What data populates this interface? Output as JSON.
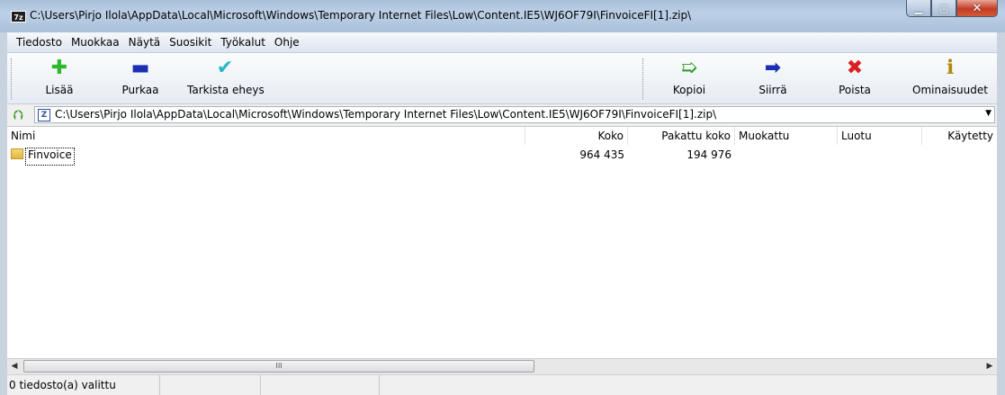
{
  "window": {
    "app_icon_label": "7z",
    "title": "C:\\Users\\Pirjo Ilola\\AppData\\Local\\Microsoft\\Windows\\Temporary Internet Files\\Low\\Content.IE5\\WJ6OF79I\\FinvoiceFI[1].zip\\",
    "min_glyph": "▁",
    "max_glyph": "▢",
    "close_glyph": "✕"
  },
  "menu": [
    "Tiedosto",
    "Muokkaa",
    "Näytä",
    "Suosikit",
    "Työkalut",
    "Ohje"
  ],
  "toolbar": {
    "add": {
      "label": "Lisää",
      "glyph": "✚",
      "icon": "plus-icon",
      "color": "#2fb82a"
    },
    "extract": {
      "label": "Purkaa",
      "glyph": "▬",
      "icon": "minus-icon",
      "color": "#1b2fb3"
    },
    "test": {
      "label": "Tarkista eheys",
      "glyph": "✔",
      "icon": "checkmark-icon",
      "color": "#28b8c8"
    },
    "copy": {
      "label": "Kopioi",
      "glyph": "➯",
      "icon": "copy-arrow-icon",
      "color": "#2a9a2a"
    },
    "move": {
      "label": "Siirrä",
      "glyph": "➡",
      "icon": "move-arrow-icon",
      "color": "#1b2fb3"
    },
    "delete": {
      "label": "Poista",
      "glyph": "✖",
      "icon": "delete-x-icon",
      "color": "#d82020"
    },
    "info": {
      "label": "Ominaisuudet",
      "glyph": "ℹ",
      "icon": "info-icon",
      "color": "#b08a10"
    }
  },
  "address": {
    "up_glyph": "⮉",
    "icon_label": "Z",
    "path": "C:\\Users\\Pirjo Ilola\\AppData\\Local\\Microsoft\\Windows\\Temporary Internet Files\\Low\\Content.IE5\\WJ6OF79I\\FinvoiceFI[1].zip\\",
    "dropdown_glyph": "▼"
  },
  "columns": [
    "Nimi",
    "Koko",
    "Pakattu koko",
    "Muokattu",
    "Luotu",
    "Käytetty"
  ],
  "rows": [
    {
      "name": "Finvoice",
      "size": "964 435",
      "packed": "194 976",
      "modified": "",
      "created": "",
      "accessed": ""
    }
  ],
  "scrollbar": {
    "left_glyph": "◀",
    "right_glyph": "▶",
    "thumb_grip": "III"
  },
  "status": {
    "selection": "0 tiedosto(a) valittu"
  }
}
